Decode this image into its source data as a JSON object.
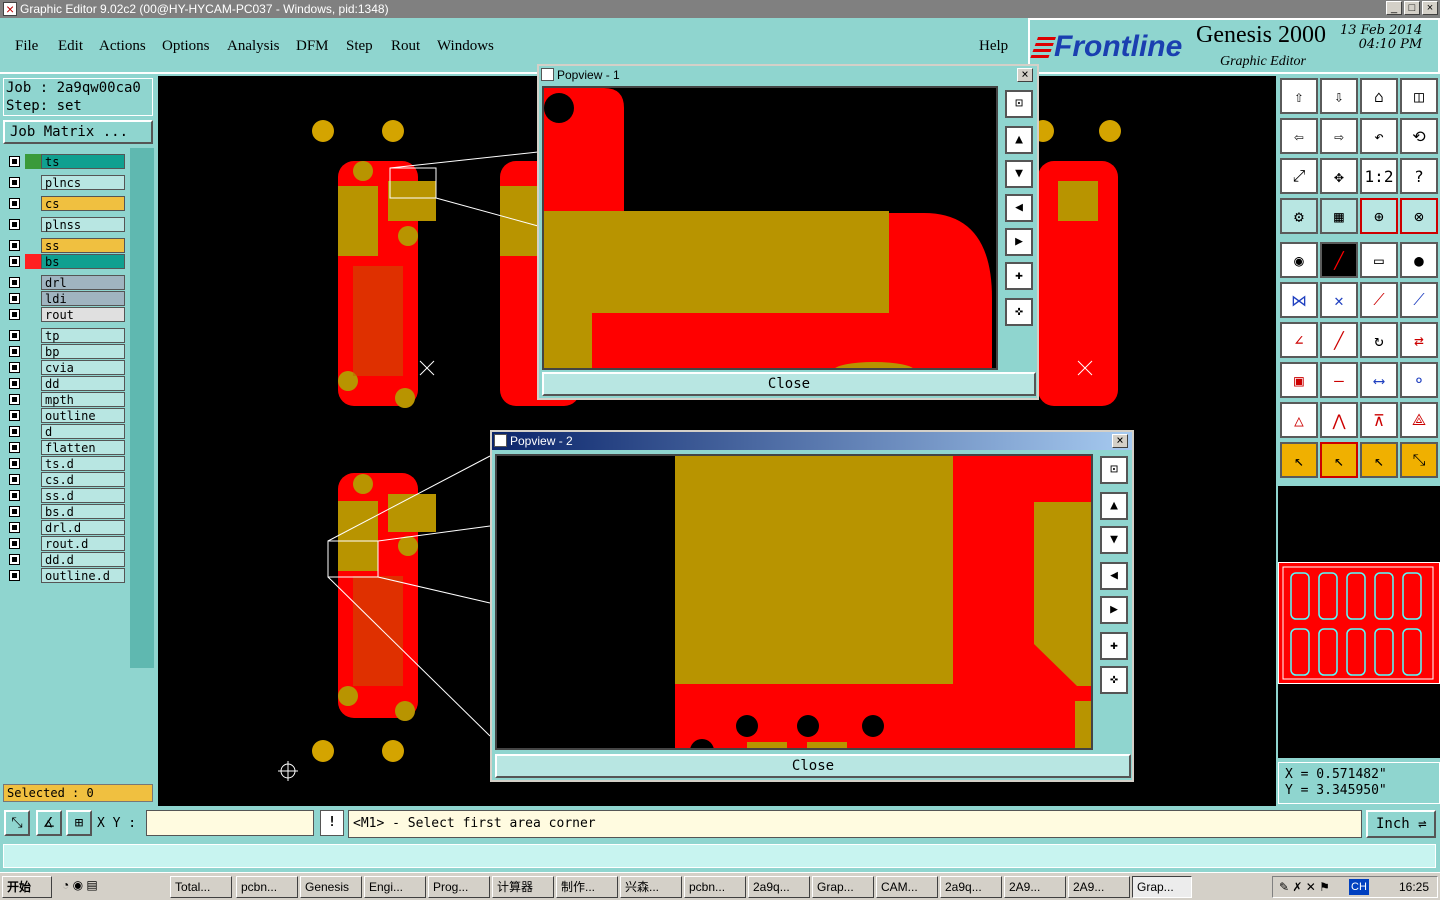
{
  "window": {
    "title": "Graphic Editor 9.02c2 (00@HY-HYCAM-PC037 - Windows, pid:1348)"
  },
  "menu": [
    "File",
    "Edit",
    "Actions",
    "Options",
    "Analysis",
    "DFM",
    "Step",
    "Rout",
    "Windows"
  ],
  "help": "Help",
  "brand": {
    "logo": "Frontline",
    "product": "Genesis 2000",
    "subtitle": "Graphic Editor",
    "date": "13 Feb 2014",
    "time": "04:10 PM"
  },
  "job": {
    "job_line": "Job : 2a9qw00ca0",
    "step_line": "Step: set",
    "matrix_button": "Job Matrix ..."
  },
  "layers": [
    {
      "name": "ts",
      "color": "#10a090",
      "swatch": "#3a9a3a"
    },
    {
      "name": "plncs",
      "color": "#b8e6e2",
      "swatch": ""
    },
    {
      "name": "cs",
      "color": "#f0c040",
      "swatch": ""
    },
    {
      "name": "plnss",
      "color": "#b8e6e2",
      "swatch": ""
    },
    {
      "name": "ss",
      "color": "#f0c040",
      "swatch": ""
    },
    {
      "name": "bs",
      "color": "#10a090",
      "swatch": "#ff2020"
    },
    {
      "name": "drl",
      "color": "#a0b4c0",
      "swatch": ""
    },
    {
      "name": "ldi",
      "color": "#a0b4c0",
      "swatch": ""
    },
    {
      "name": "rout",
      "color": "#e0e0e0",
      "swatch": ""
    },
    {
      "name": "tp",
      "color": "#b8e6e2",
      "swatch": ""
    },
    {
      "name": "bp",
      "color": "#b8e6e2",
      "swatch": ""
    },
    {
      "name": "cvia",
      "color": "#b8e6e2",
      "swatch": ""
    },
    {
      "name": "dd",
      "color": "#b8e6e2",
      "swatch": ""
    },
    {
      "name": "mpth",
      "color": "#b8e6e2",
      "swatch": ""
    },
    {
      "name": "outline",
      "color": "#b8e6e2",
      "swatch": ""
    },
    {
      "name": "d",
      "color": "#b8e6e2",
      "swatch": ""
    },
    {
      "name": "flatten",
      "color": "#b8e6e2",
      "swatch": ""
    },
    {
      "name": "ts.d",
      "color": "#b8e6e2",
      "swatch": ""
    },
    {
      "name": "cs.d",
      "color": "#b8e6e2",
      "swatch": ""
    },
    {
      "name": "ss.d",
      "color": "#b8e6e2",
      "swatch": ""
    },
    {
      "name": "bs.d",
      "color": "#b8e6e2",
      "swatch": ""
    },
    {
      "name": "drl.d",
      "color": "#b8e6e2",
      "swatch": ""
    },
    {
      "name": "rout.d",
      "color": "#b8e6e2",
      "swatch": ""
    },
    {
      "name": "dd.d",
      "color": "#b8e6e2",
      "swatch": ""
    },
    {
      "name": "outline.d",
      "color": "#b8e6e2",
      "swatch": ""
    }
  ],
  "selected": "Selected : 0",
  "popview1": {
    "title": "Popview - 1",
    "close": "Close"
  },
  "popview2": {
    "title": "Popview - 2",
    "close": "Close"
  },
  "tools": {
    "one_to_two": "1:2",
    "help": "?"
  },
  "coords": {
    "x": "X = 0.571482\"",
    "y": "Y = 3.345950\""
  },
  "bottom": {
    "xy_label": "X Y :",
    "xy_value": "",
    "bang": "!",
    "prompt": "<M1> - Select first area corner",
    "unit": "Inch"
  },
  "taskbar": {
    "start": "开始",
    "tasks": [
      "Total...",
      "pcbn...",
      "Genesis",
      "Engi...",
      "Prog...",
      "计算器",
      "制作...",
      "兴森...",
      "pcbn...",
      "2a9q...",
      "Grap...",
      "CAM...",
      "2a9q...",
      "2A9...",
      "2A9...",
      "Grap..."
    ],
    "clock": "16:25",
    "tray_lang": "CH"
  },
  "colors": {
    "bg": "#8fd5cf",
    "copper": "#ff0000",
    "gold": "#b89400",
    "pad": "#d4a400"
  }
}
